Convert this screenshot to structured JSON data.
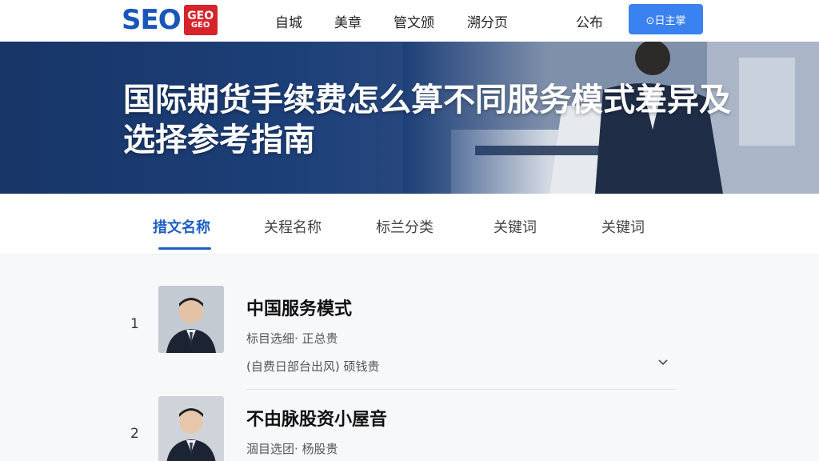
{
  "header": {
    "logo_text": "SEO",
    "logo_badge_top": "GEO",
    "logo_badge_bottom": "GEO",
    "nav": [
      "自城",
      "美章",
      "管文颁",
      "溯分页",
      "公布"
    ],
    "cta_label": "⊙日主掌"
  },
  "banner": {
    "title": "国际期货手续费怎么算不同服务模式差异及选择参考指南"
  },
  "tabs": [
    "措文名称",
    "关程名称",
    "标兰分类",
    "关键词",
    "关键词"
  ],
  "active_tab": 0,
  "list": [
    {
      "rank": "1",
      "name": "中国服务模式",
      "meta1": "标目选细· 正总贵",
      "meta2": "(自费日部台出风) 硕钱贵"
    },
    {
      "rank": "2",
      "name": "不由脉股资小屋音",
      "meta1": "涸目选团· 杨股贵"
    }
  ],
  "colors": {
    "brand_blue": "#1a56b8",
    "badge_red": "#d6252a",
    "cta_blue": "#3a82f0",
    "tab_active": "#1d5ec4",
    "banner_dark": "#173567"
  }
}
